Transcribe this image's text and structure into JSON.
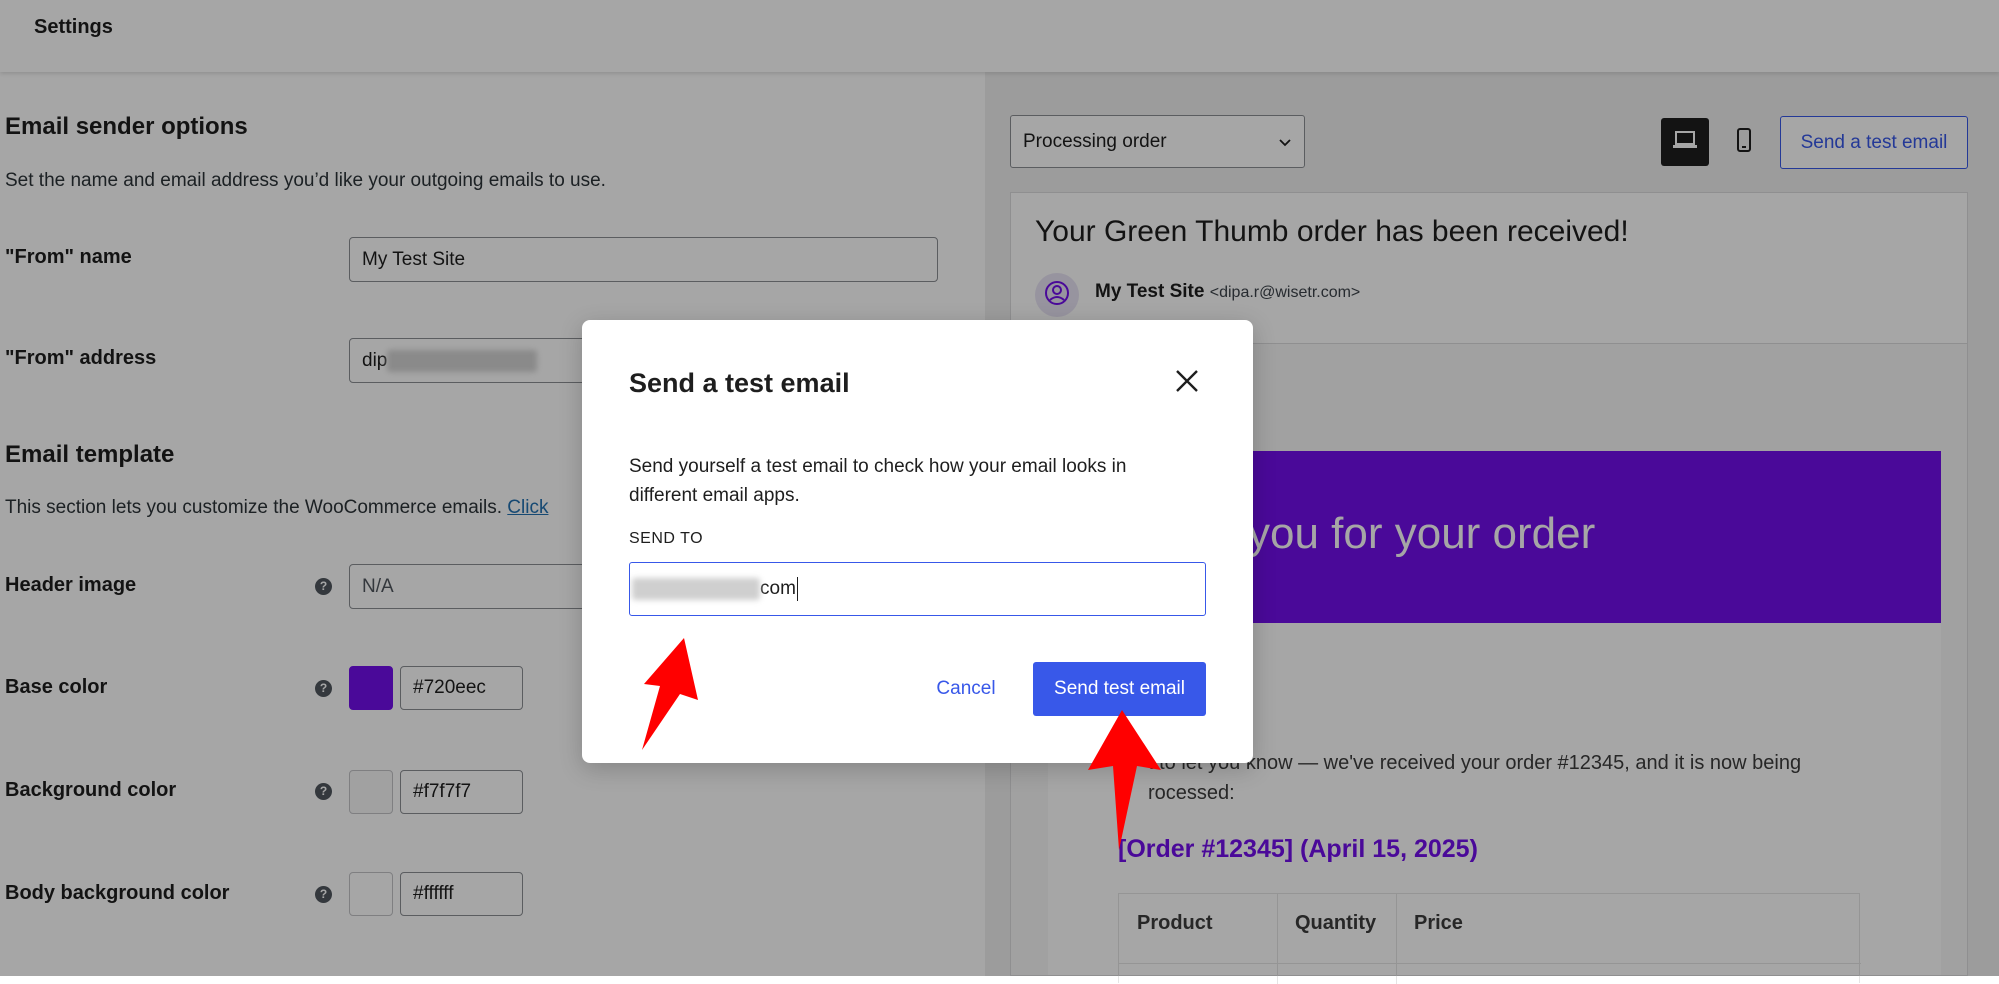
{
  "header": {
    "title": "Settings"
  },
  "sender_options": {
    "heading": "Email sender options",
    "description": "Set the name and email address you’d like your outgoing emails to use.",
    "from_name_label": "\"From\" name",
    "from_name_value": "My Test Site",
    "from_address_label": "\"From\" address",
    "from_address_value_visible": "dip"
  },
  "template": {
    "heading": "Email template",
    "description": "This section lets you customize the WooCommerce emails.",
    "link_text": "Click",
    "header_image_label": "Header image",
    "header_image_value": "N/A",
    "base_color_label": "Base color",
    "base_color_value": "#720eec",
    "background_color_label": "Background color",
    "background_color_value": "#f7f7f7",
    "body_background_label": "Body background color",
    "body_background_value": "#ffffff"
  },
  "preview": {
    "email_type": "Processing order",
    "send_test_button": "Send a test email",
    "subject": "Your Green Thumb order has been received!",
    "sender_name": "My Test Site",
    "sender_email": "<dipa.r@wisetr.com>",
    "banner_text": "you for your order",
    "body_text": "t to let you know — we've received your order #12345, and it is now being",
    "body_text_2": "rocessed:",
    "order_title": "[Order #12345] (April 15, 2025)",
    "table_headers": [
      "Product",
      "Quantity",
      "Price"
    ]
  },
  "modal": {
    "title": "Send a test email",
    "description": "Send yourself a test email to check how your email looks in different email apps.",
    "send_to_label": "SEND TO",
    "email_value_visible": "com",
    "cancel_label": "Cancel",
    "send_label": "Send test email"
  },
  "colors": {
    "accent": "#3858e9",
    "brand_purple": "#720eec",
    "arrow": "#ff0000"
  }
}
